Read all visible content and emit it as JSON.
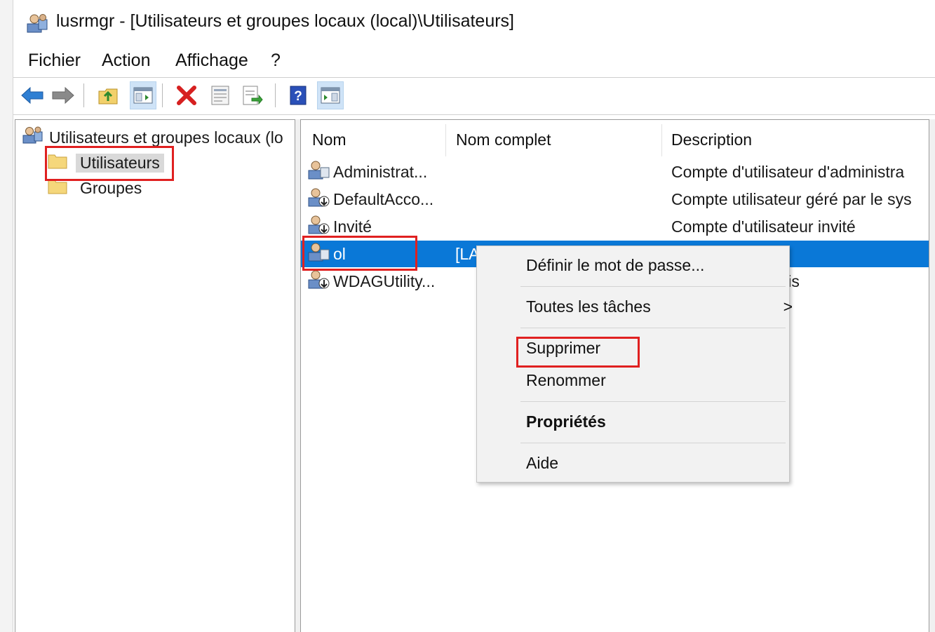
{
  "window": {
    "title": "lusrmgr - [Utilisateurs et groupes locaux (local)\\Utilisateurs]"
  },
  "menu": [
    "Fichier",
    "Action",
    "Affichage",
    "?"
  ],
  "toolbar": {
    "buttons": [
      "back-arrow-icon",
      "forward-arrow-icon",
      "up-folder-icon",
      "show-hide-tree-icon",
      "delete-icon",
      "properties-icon",
      "export-list-icon",
      "help-icon",
      "show-action-pane-icon"
    ]
  },
  "tree": {
    "root_label": "Utilisateurs et groupes locaux (lo",
    "nodes": [
      {
        "label": "Utilisateurs",
        "selected": true
      },
      {
        "label": "Groupes",
        "selected": false
      }
    ]
  },
  "list": {
    "columns": [
      "Nom",
      "Nom complet",
      "Description"
    ],
    "rows": [
      {
        "name": "Administrat...",
        "full_name": "",
        "description": "Compte d'utilisateur d'administra"
      },
      {
        "name": "DefaultAcco...",
        "full_name": "",
        "description": "Compte utilisateur géré par le sys"
      },
      {
        "name": "Invité",
        "full_name": "",
        "description": "Compte d'utilisateur invité"
      },
      {
        "name": "ol",
        "full_name": "[LA",
        "description": "",
        "selected": true
      },
      {
        "name": "WDAGUtility...",
        "full_name": "",
        "description": "ateur géré et utilis"
      }
    ]
  },
  "context_menu": {
    "items": [
      {
        "label": "Définir le mot de passe...",
        "bold": false
      },
      {
        "label": "Toutes les tâches",
        "bold": false,
        "submenu_arrow": ">"
      },
      {
        "label": "Supprimer",
        "bold": false
      },
      {
        "label": "Renommer",
        "bold": false
      },
      {
        "label": "Propriétés",
        "bold": true
      },
      {
        "label": "Aide",
        "bold": false
      }
    ]
  },
  "colors": {
    "selection": "#0a78d7",
    "highlight_box": "#e02020"
  }
}
